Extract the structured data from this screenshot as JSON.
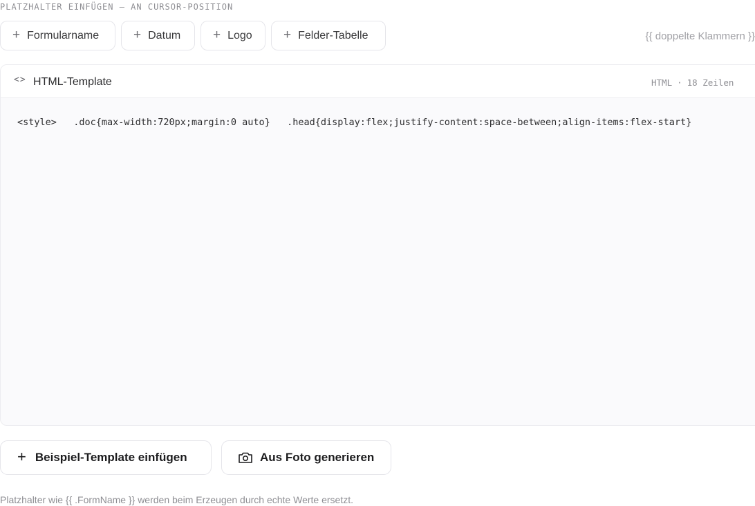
{
  "section_label": "PLATZHALTER EINFÜGEN — AN CURSOR-POSITION",
  "placeholder_chips": [
    {
      "label": "Formularname",
      "icon": "plus-icon"
    },
    {
      "label": "Datum",
      "icon": "plus-icon"
    },
    {
      "label": "Logo",
      "icon": "plus-icon"
    },
    {
      "label": "Felder-Tabelle",
      "icon": "plus-icon"
    }
  ],
  "syntax_hint": "{{ doppelte Klammern }}",
  "editor": {
    "icon": "code-icon",
    "title": "HTML-Template",
    "language": "HTML",
    "line_count": "18 Zeilen",
    "content": "<style>   .doc{max-width:720px;margin:0 auto}   .head{display:flex;justify-content:space-between;align-items:flex-start}"
  },
  "actions": {
    "example_label": "Beispiel-Template einfügen",
    "photo_label": "Aus Foto generieren"
  },
  "footnote": "Platzhalter wie {{ .FormName }} werden beim Erzeugen durch echte Werte ersetzt.",
  "colors": {
    "border": "#e5e5ea",
    "muted_text": "#8e8e93",
    "editor_bg": "#fafafc"
  }
}
